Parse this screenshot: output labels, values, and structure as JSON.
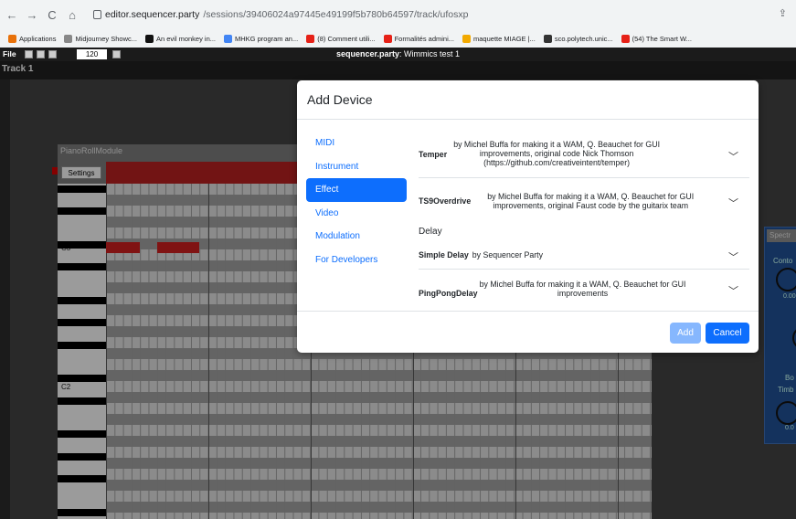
{
  "browser": {
    "nav": {
      "back": "←",
      "forward": "→",
      "reload": "C",
      "home": "⌂"
    },
    "url_host": "editor.sequencer.party",
    "url_path": "/sessions/39406024a97445e49199f5b780b64597/track/ufosxp",
    "bookmarks": [
      {
        "label": "Applications",
        "color": "#e8710a"
      },
      {
        "label": "Midjourney Showc...",
        "color": "#888888"
      },
      {
        "label": "An evil monkey in...",
        "color": "#111111"
      },
      {
        "label": "MHKG program an...",
        "color": "#4285f4"
      },
      {
        "label": "(8) Comment utili...",
        "color": "#e62117"
      },
      {
        "label": "Formalités admini...",
        "color": "#e62117"
      },
      {
        "label": "maquette MIAGE |...",
        "color": "#f2a900"
      },
      {
        "label": "sco.polytech.unic...",
        "color": "#333333"
      },
      {
        "label": "(54) The Smart W...",
        "color": "#e62117"
      }
    ]
  },
  "app": {
    "file_label": "File",
    "tempo": "120",
    "title_bold": "sequencer.party",
    "title_rest": ": Wimmics test 1",
    "track_name": "Track 1"
  },
  "piano_roll": {
    "title": "PianoRollModule",
    "settings_label": "Settings",
    "labels": {
      "c3": "C3",
      "c2": "C2"
    }
  },
  "spectrum": {
    "title": "Spectr",
    "contour": "Conto",
    "val1": "0.00",
    "bo": "Bo",
    "timb": "Timb",
    "val2": "0.0"
  },
  "modal": {
    "title": "Add Device",
    "nav": [
      "MIDI",
      "Instrument",
      "Effect",
      "Video",
      "Modulation",
      "For Developers"
    ],
    "active_nav": "Effect",
    "devices": [
      {
        "name": "Temper",
        "desc": "by Michel Buffa for making it a WAM, Q. Beauchet for GUI improvements, original code Nick Thomson (https://github.com/creativeintent/temper)"
      },
      {
        "name": "TS9Overdrive",
        "desc": "by Michel Buffa for making it a WAM, Q. Beauchet for GUI improvements, original Faust code by the guitarix team"
      },
      {
        "name": "Simple Delay",
        "desc": "by Sequencer Party"
      },
      {
        "name": "PingPongDelay",
        "desc": "by Michel Buffa for making it a WAM, Q. Beauchet for GUI improvements"
      }
    ],
    "category_delay": "Delay",
    "add_label": "Add",
    "cancel_label": "Cancel",
    "colors": {
      "primary": "#0d6efd",
      "primary_disabled": "#86b7fe"
    }
  }
}
